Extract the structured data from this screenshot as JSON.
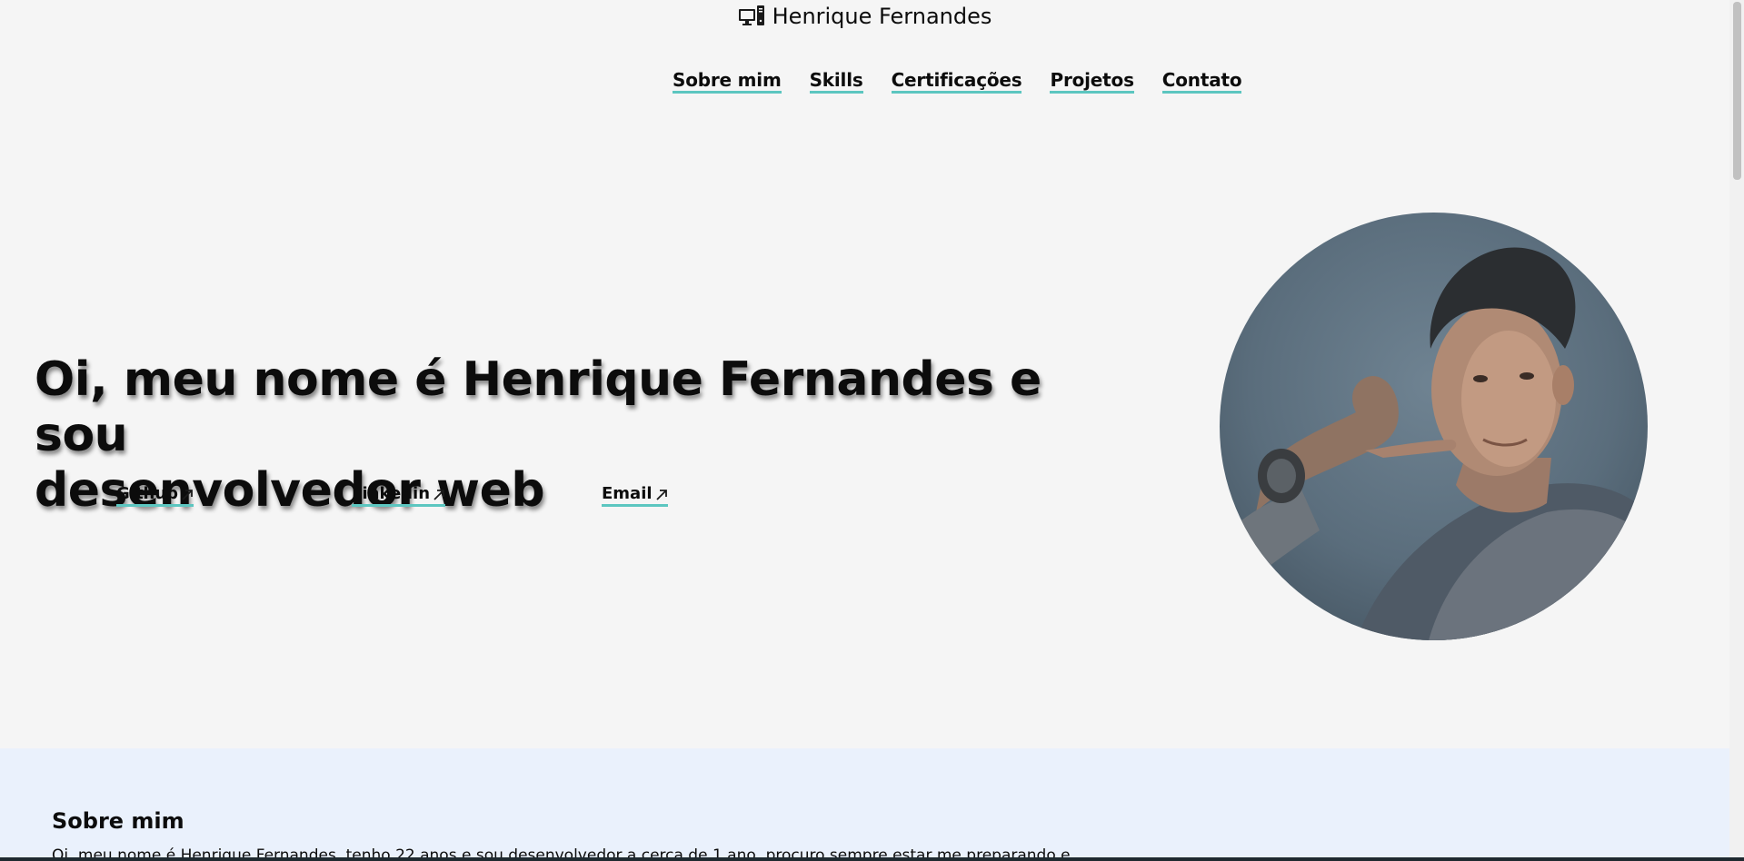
{
  "brand": {
    "icon": "computer-icon",
    "name": "Henrique Fernandes"
  },
  "nav": {
    "items": [
      {
        "label": "Sobre mim"
      },
      {
        "label": "Skills"
      },
      {
        "label": "Certificações"
      },
      {
        "label": "Projetos"
      },
      {
        "label": "Contato"
      }
    ],
    "underline_color": "#5cc6c0"
  },
  "hero": {
    "title_line1": "Oi, meu nome é Henrique Fernandes e sou",
    "title_line2": "desenvolvedor web",
    "links": [
      {
        "label": "Github",
        "icon": "arrow-up-right-icon"
      },
      {
        "label": "Linkedin",
        "icon": "arrow-up-right-icon"
      },
      {
        "label": "Email",
        "icon": "arrow-up-right-icon"
      }
    ]
  },
  "about": {
    "heading": "Sobre mim",
    "text": "Oi, meu nome é Henrique Fernandes, tenho 22 anos e sou desenvolvedor a cerca de 1 ano, procuro sempre estar me preparando e"
  },
  "colors": {
    "background": "#f5f5f5",
    "about_background": "#eaf1fc",
    "accent": "#5cc6c0"
  }
}
